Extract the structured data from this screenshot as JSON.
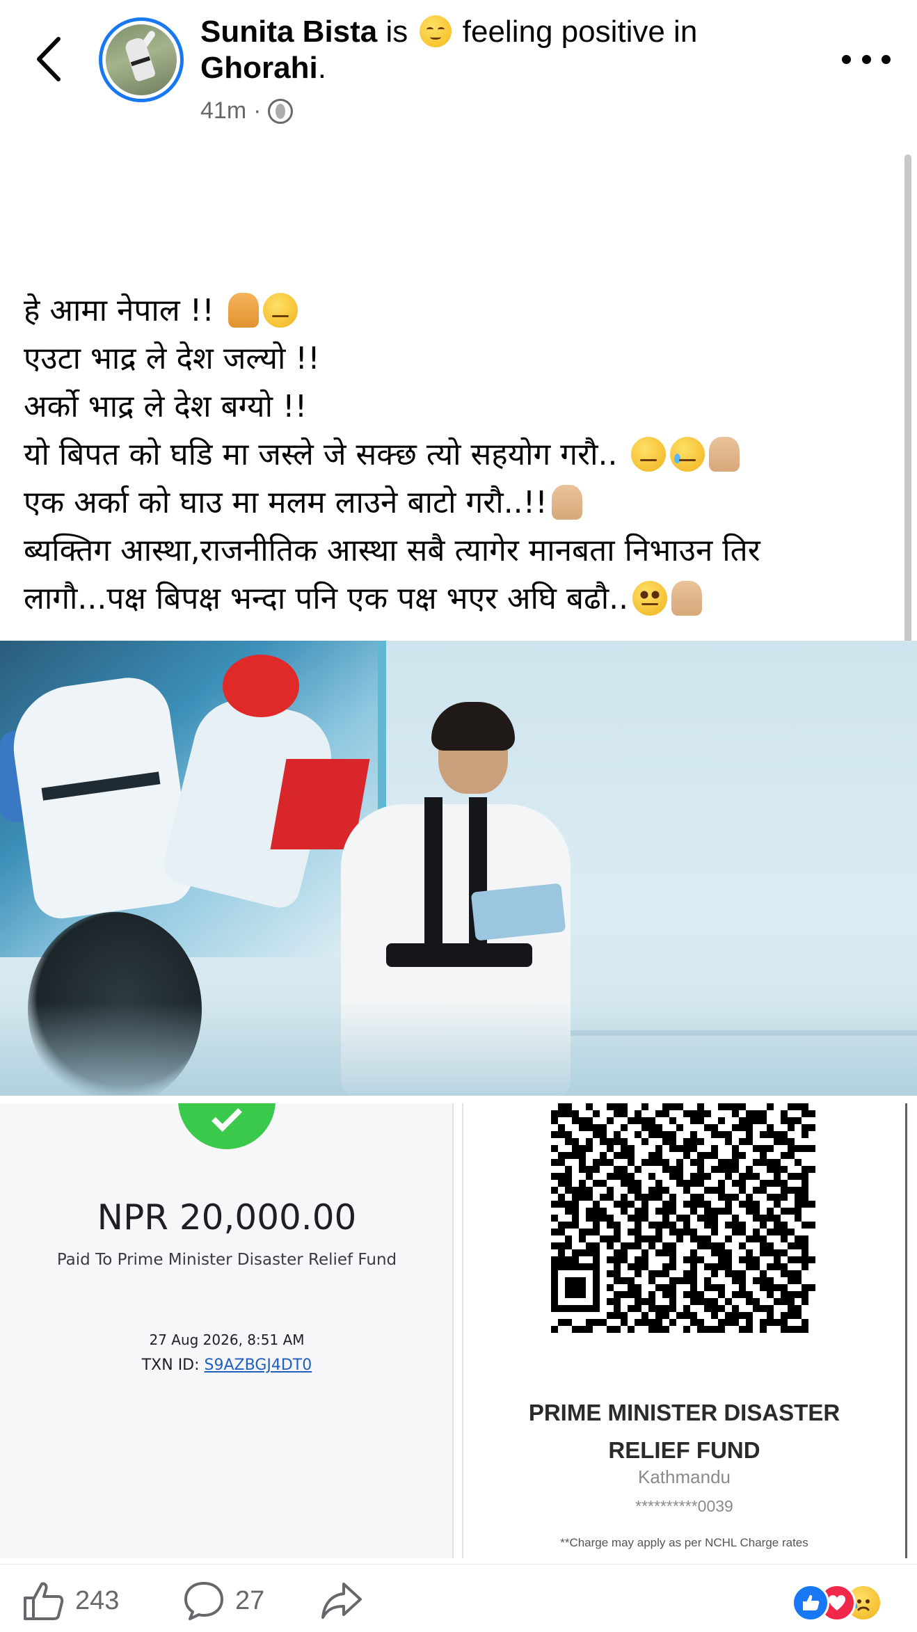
{
  "header": {
    "author_name": "Sunita Bista",
    "is_text": "is",
    "feeling_text": "feeling positive in",
    "place": "Ghorahi",
    "place_suffix": ".",
    "time": "41m",
    "separator": "·",
    "privacy_icon": "globe-icon",
    "back_icon": "chevron-left-icon",
    "more_icon": "more-horizontal-icon"
  },
  "post": {
    "lines": [
      "हे आमा नेपाल !!",
      "एउटा भाद्र ले देश जल्यो !!",
      "अर्को भाद्र ले देश बग्यो !!",
      "यो बिपत को घडि मा जस्ले जे सक्छ त्यो सहयोग गरौ..",
      "एक अर्का को घाउ मा मलम लाउने बाटो गरौ..!!",
      "ब्यक्तिग आस्था,राजनीतिक आस्था सबै त्यागेर मानबता निभाउन तिर",
      "लागौ...पक्ष बिपक्ष भन्दा पनि एक पक्ष भएर अघि बढौ.."
    ]
  },
  "receipt": {
    "amount": "NPR 20,000.00",
    "paid_to": "Paid To Prime Minister Disaster Relief Fund",
    "date": "27 Aug 2026, 8:51 AM",
    "txn_label": "TXN ID:",
    "txn_id": "S9AZBGJ4DT0",
    "status_icon": "check-circle-icon"
  },
  "qr": {
    "title_line1": "PRIME MINISTER DISASTER",
    "title_line2": "RELIEF FUND",
    "city": "Kathmandu",
    "account": "**********0039",
    "note": "**Charge may apply as per NCHL Charge rates"
  },
  "actions": {
    "like_count": "243",
    "comment_count": "27",
    "like_icon": "thumbs-up-icon",
    "comment_icon": "comment-icon",
    "share_icon": "share-icon",
    "reactions": [
      "like",
      "love",
      "sad"
    ]
  },
  "colors": {
    "accent": "#1877f2",
    "text": "#050505",
    "secondary_text": "#65676b",
    "success_green": "#3ac94a",
    "love_red": "#f02849"
  }
}
